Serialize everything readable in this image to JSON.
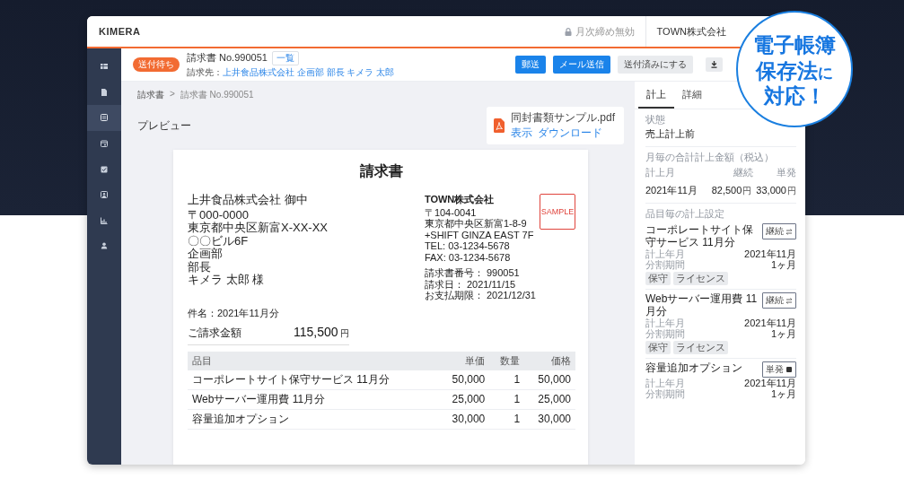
{
  "app": {
    "logo": "KIMERA",
    "lock_status": "月次締め無効",
    "company": "TOWN株式会社"
  },
  "sidebar": {
    "items": [
      {
        "kind": "table",
        "selected": false
      },
      {
        "kind": "document",
        "selected": false
      },
      {
        "kind": "list",
        "selected": true
      },
      {
        "kind": "calendar",
        "selected": false
      },
      {
        "kind": "check",
        "selected": false
      },
      {
        "kind": "image",
        "selected": false
      },
      {
        "kind": "chart",
        "selected": false
      },
      {
        "kind": "person",
        "selected": false
      }
    ]
  },
  "toolbar": {
    "status_badge": "送付待ち",
    "title": "請求書 No.990051",
    "list_button": "一覧",
    "recipient_label": "請求先：",
    "recipient": "上井食品株式会社 企画部 部長 キメラ 太郎",
    "buttons": [
      {
        "label": "郵送",
        "kind": "primary"
      },
      {
        "label": "メール送信",
        "kind": "primary"
      },
      {
        "label": "送付済みにする",
        "kind": "secondary"
      }
    ]
  },
  "breadcrumb": {
    "items": [
      "請求書",
      "請求書 No.990051"
    ],
    "separator": ">"
  },
  "preview_label": "プレビュー",
  "attachment": {
    "filename": "同封書類サンプル.pdf",
    "links": [
      "表示",
      "ダウンロード"
    ]
  },
  "invoice": {
    "title": "請求書",
    "recipient_lines": [
      "上井食品株式会社 御中",
      "〒000-0000",
      "東京都中央区新富X-XX-XX",
      "〇〇ビル6F",
      "企画部",
      "部長",
      "キメラ 太郎 様"
    ],
    "issuer_name": "TOWN株式会社",
    "issuer_lines": [
      "〒104-0041",
      "東京都中央区新富1-8-9",
      "+SHIFT GINZA EAST 7F",
      "TEL: 03-1234-5678",
      "FAX: 03-1234-5678"
    ],
    "meta_lines": [
      "請求書番号： 990051",
      "請求日： 2021/11/15",
      "お支払期限： 2021/12/31"
    ],
    "stamp": "SAMPLE",
    "subject": "件名：2021年11月分",
    "total_label": "ご請求金額",
    "total": "115,500",
    "currency": "円",
    "columns": [
      "品目",
      "単価",
      "数量",
      "価格"
    ],
    "rows": [
      [
        "コーポレートサイト保守サービス 11月分",
        "50,000",
        "1",
        "50,000"
      ],
      [
        "Webサーバー運用費 11月分",
        "25,000",
        "1",
        "25,000"
      ],
      [
        "容量追加オプション",
        "30,000",
        "1",
        "30,000"
      ]
    ]
  },
  "side_panel": {
    "tabs": [
      {
        "label": "計上",
        "selected": true
      },
      {
        "label": "詳細",
        "selected": false
      }
    ],
    "status_label": "状態",
    "status": "売上計上前",
    "monthly_title": "月毎の合計計上金額（税込）",
    "monthly_columns": [
      "計上月",
      "継続",
      "単発"
    ],
    "monthly_rows": [
      {
        "month": "2021年11月",
        "amounts": [
          {
            "value": "82,500",
            "unit": "円"
          },
          {
            "value": "33,000",
            "unit": "円"
          }
        ]
      }
    ],
    "items_title": "品目毎の計上設定",
    "items": [
      {
        "name": "コーポレートサイト保守サービス 11月分",
        "type_label": "継続",
        "kind": "recurring",
        "meta": [
          {
            "label": "計上年月",
            "value": "2021年11月"
          },
          {
            "label": "分割期間",
            "value": "1ヶ月"
          }
        ],
        "tags": [
          "保守",
          "ライセンス"
        ]
      },
      {
        "name": "Webサーバー運用費 11月分",
        "type_label": "継続",
        "kind": "recurring",
        "meta": [
          {
            "label": "計上年月",
            "value": "2021年11月"
          },
          {
            "label": "分割期間",
            "value": "1ヶ月"
          }
        ],
        "tags": [
          "保守",
          "ライセンス"
        ]
      },
      {
        "name": "容量追加オプション",
        "type_label": "単発",
        "kind": "single",
        "meta": [
          {
            "label": "計上年月",
            "value": "2021年11月"
          },
          {
            "label": "分割期間",
            "value": "1ヶ月"
          }
        ]
      }
    ]
  },
  "promo_badge": {
    "lines": [
      [
        {
          "text": "電子帳簿",
          "small": false
        }
      ],
      [
        {
          "text": "保存法",
          "small": false
        },
        {
          "text": "に",
          "small": true
        }
      ],
      [
        {
          "text": "対応！",
          "small": false
        }
      ]
    ]
  }
}
